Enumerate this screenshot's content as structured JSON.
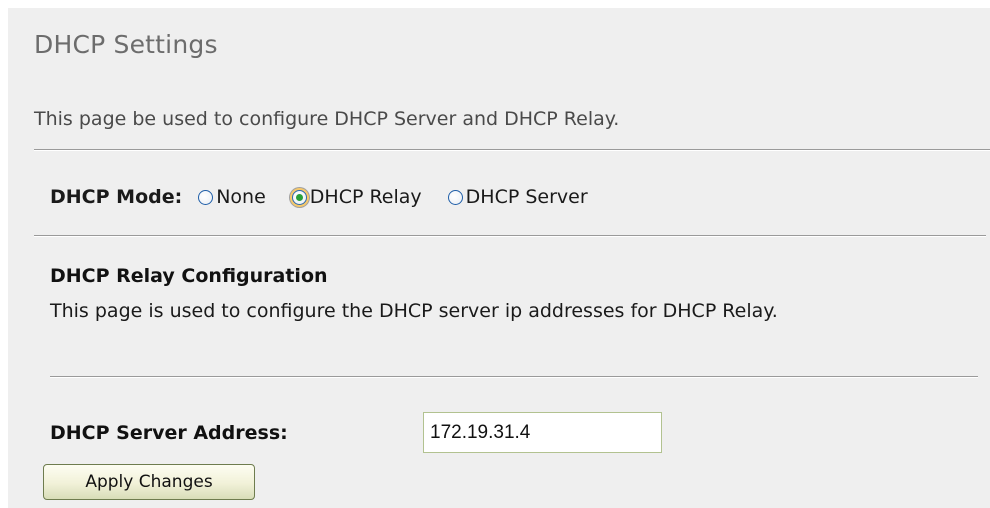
{
  "page": {
    "title": "DHCP Settings",
    "description": "This page be used to configure DHCP Server and DHCP Relay."
  },
  "mode": {
    "label": "DHCP Mode:",
    "options": [
      {
        "label": "None",
        "checked": false
      },
      {
        "label": "DHCP Relay",
        "checked": true
      },
      {
        "label": "DHCP Server",
        "checked": false
      }
    ],
    "selected": "DHCP Relay"
  },
  "relay": {
    "title": "DHCP Relay Configuration",
    "description": "This page is used to configure the DHCP server ip addresses for DHCP Relay."
  },
  "server": {
    "label": "DHCP Server Address:",
    "value": "172.19.31.4"
  },
  "actions": {
    "apply_label": "Apply Changes"
  },
  "colors": {
    "panel_background": "#efefef",
    "title_text": "#6c6c6c",
    "radio_selected_dot": "#27a03a",
    "button_border": "#6e7c4e"
  }
}
